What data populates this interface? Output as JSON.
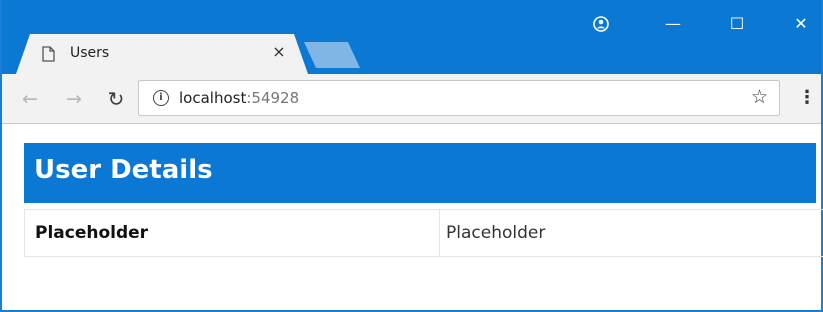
{
  "browser": {
    "tab": {
      "title": "Users",
      "close_glyph": "×"
    },
    "window_controls": {
      "minimize": "—",
      "maximize": "☐",
      "close": "✕"
    },
    "nav": {
      "back": "←",
      "forward": "→",
      "reload": "↻"
    },
    "address": {
      "host": "localhost",
      "port": ":54928"
    },
    "icons": [
      "page-icon",
      "profile-icon",
      "info-icon",
      "star-icon",
      "menu-icon"
    ],
    "accent_color": "#0b78d4"
  },
  "page": {
    "heading": "User Details",
    "rows": [
      {
        "label": "Placeholder",
        "value": "Placeholder"
      }
    ]
  }
}
